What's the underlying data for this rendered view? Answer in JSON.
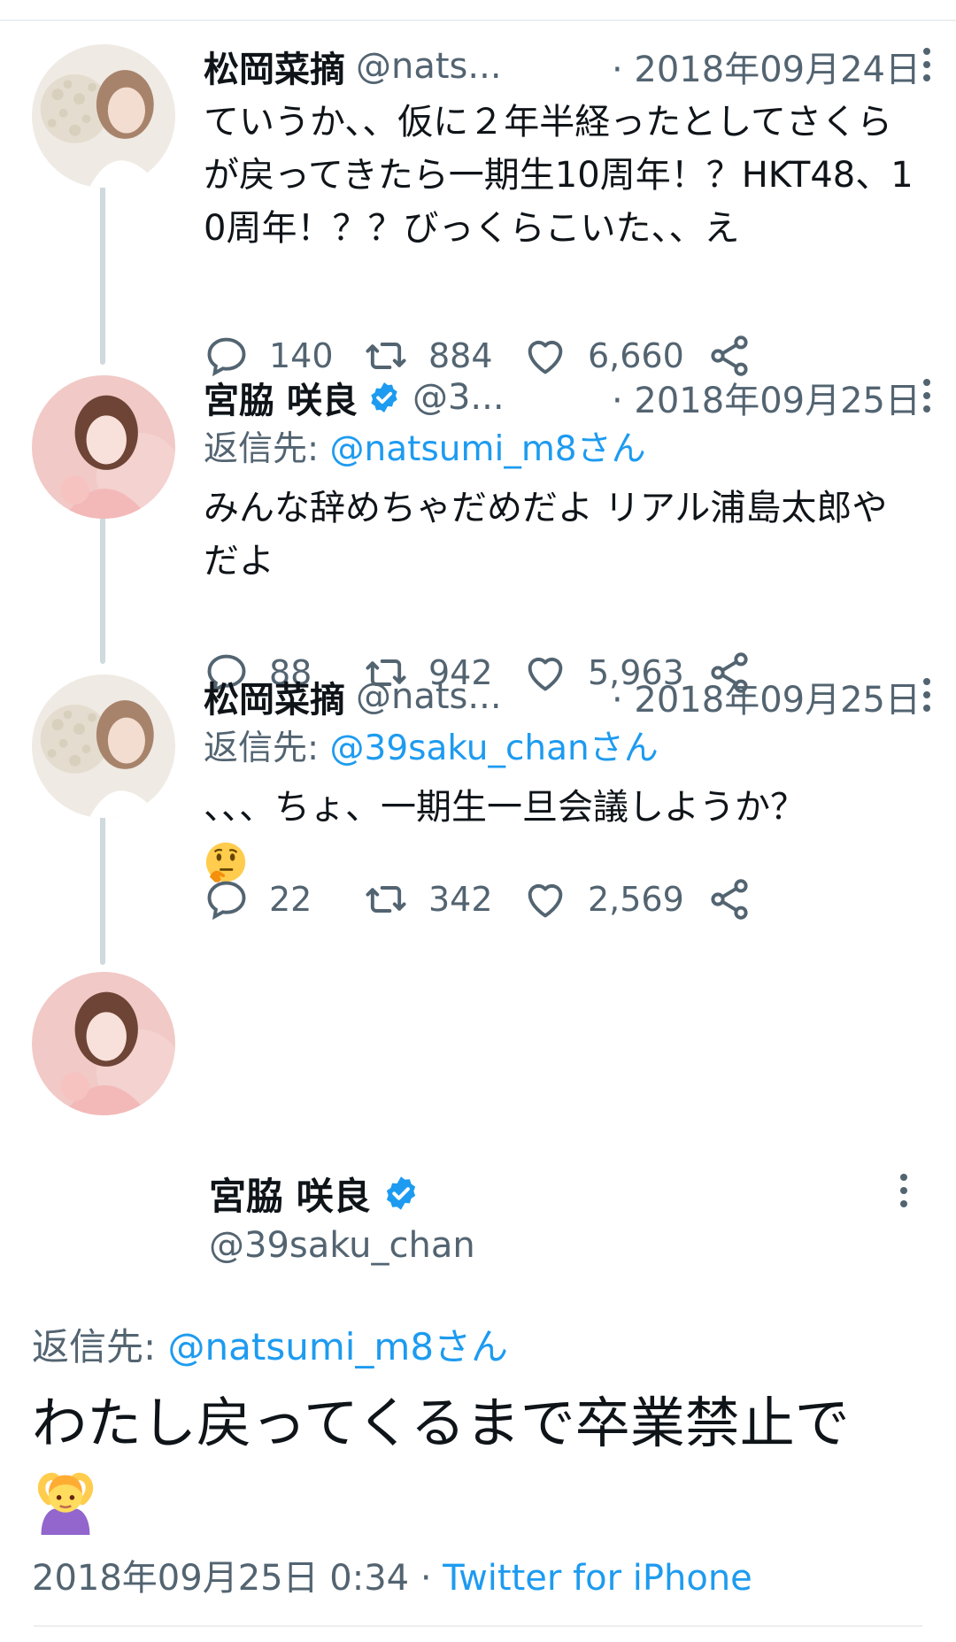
{
  "tweets": [
    {
      "name": "松岡菜摘",
      "handle": "@nats...",
      "date": "· 2018年09月24日",
      "text": "ていうか、、仮に２年半経ったとしてさくらが戻ってきたら一期生10周年！？HKT48、10周年！？？びっくらこいた、、え",
      "replies": "140",
      "retweets": "884",
      "likes": "6,660"
    },
    {
      "name": "宮脇 咲良",
      "handle": "@3...",
      "date": "· 2018年09月25日",
      "reply_label": "返信先: ",
      "reply_to": "@natsumi_m8さん",
      "text": "みんな辞めちゃだめだよ リアル浦島太郎やだよ",
      "replies": "88",
      "retweets": "942",
      "likes": "5,963"
    },
    {
      "name": "松岡菜摘",
      "handle": "@nats...",
      "date": "· 2018年09月25日",
      "reply_label": "返信先: ",
      "reply_to": "@39saku_chanさん",
      "text": "、、、ちょ、一期生一旦会議しようか？",
      "replies": "22",
      "retweets": "342",
      "likes": "2,569"
    }
  ],
  "main": {
    "name": "宮脇 咲良",
    "handle": "@39saku_chan",
    "reply_label": "返信先: ",
    "reply_to": "@natsumi_m8さん",
    "text": "わたし戻ってくるまで卒業禁止で",
    "timestamp": "2018年09月25日 0:34 · ",
    "client": "Twitter for iPhone"
  },
  "icons": {
    "reply": "reply-icon",
    "retweet": "retweet-icon",
    "like": "heart-icon",
    "share": "share-icon",
    "more": "more-icon",
    "verified": "verified-badge-icon",
    "emoji_thinking": "thinking-face-emoji",
    "emoji_gesture": "person-gesturing-ok-emoji"
  },
  "colors": {
    "accent": "#1d9bf0",
    "secondary_text": "#536471",
    "primary_text": "#0f1419",
    "thread_line": "#cfd9de"
  }
}
